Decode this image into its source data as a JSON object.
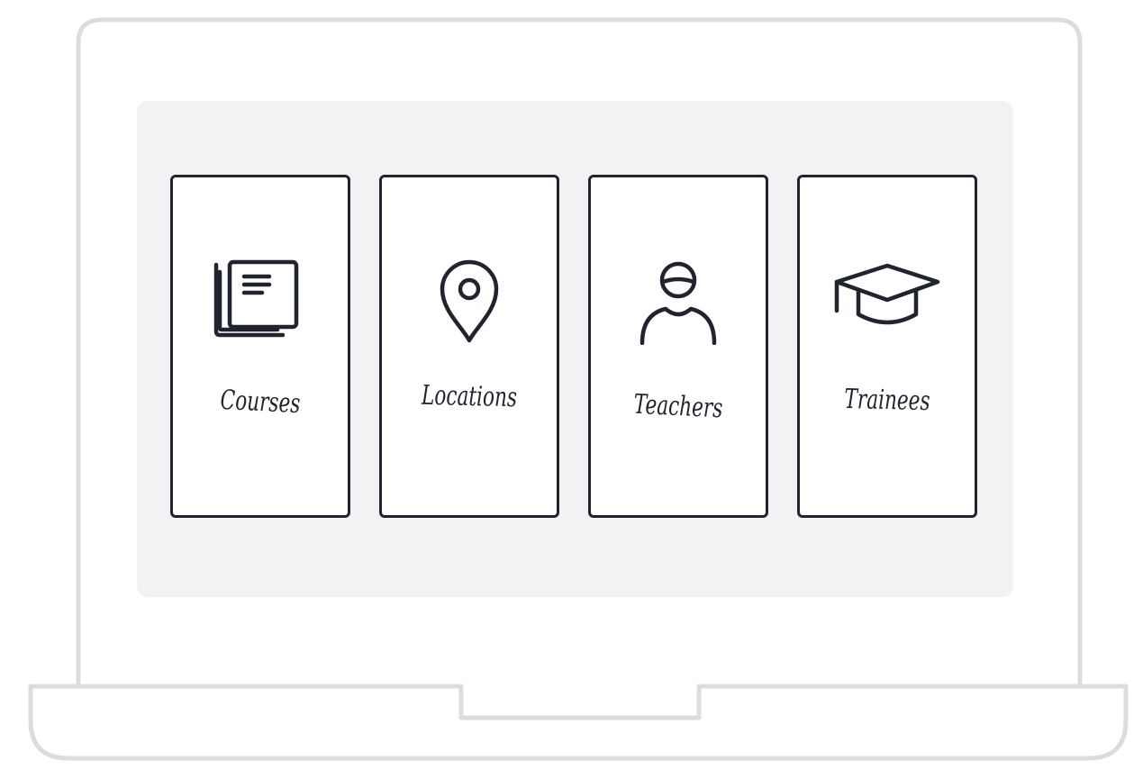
{
  "colors": {
    "frame": "#dcdcdf",
    "panel": "#f2f2f4",
    "tile_border": "#20242e",
    "ink": "#20242e"
  },
  "tiles": [
    {
      "label": "Courses",
      "icon": "document-stack-icon"
    },
    {
      "label": "Locations",
      "icon": "map-pin-icon"
    },
    {
      "label": "Teachers",
      "icon": "person-icon"
    },
    {
      "label": "Trainees",
      "icon": "graduation-cap-icon"
    }
  ]
}
